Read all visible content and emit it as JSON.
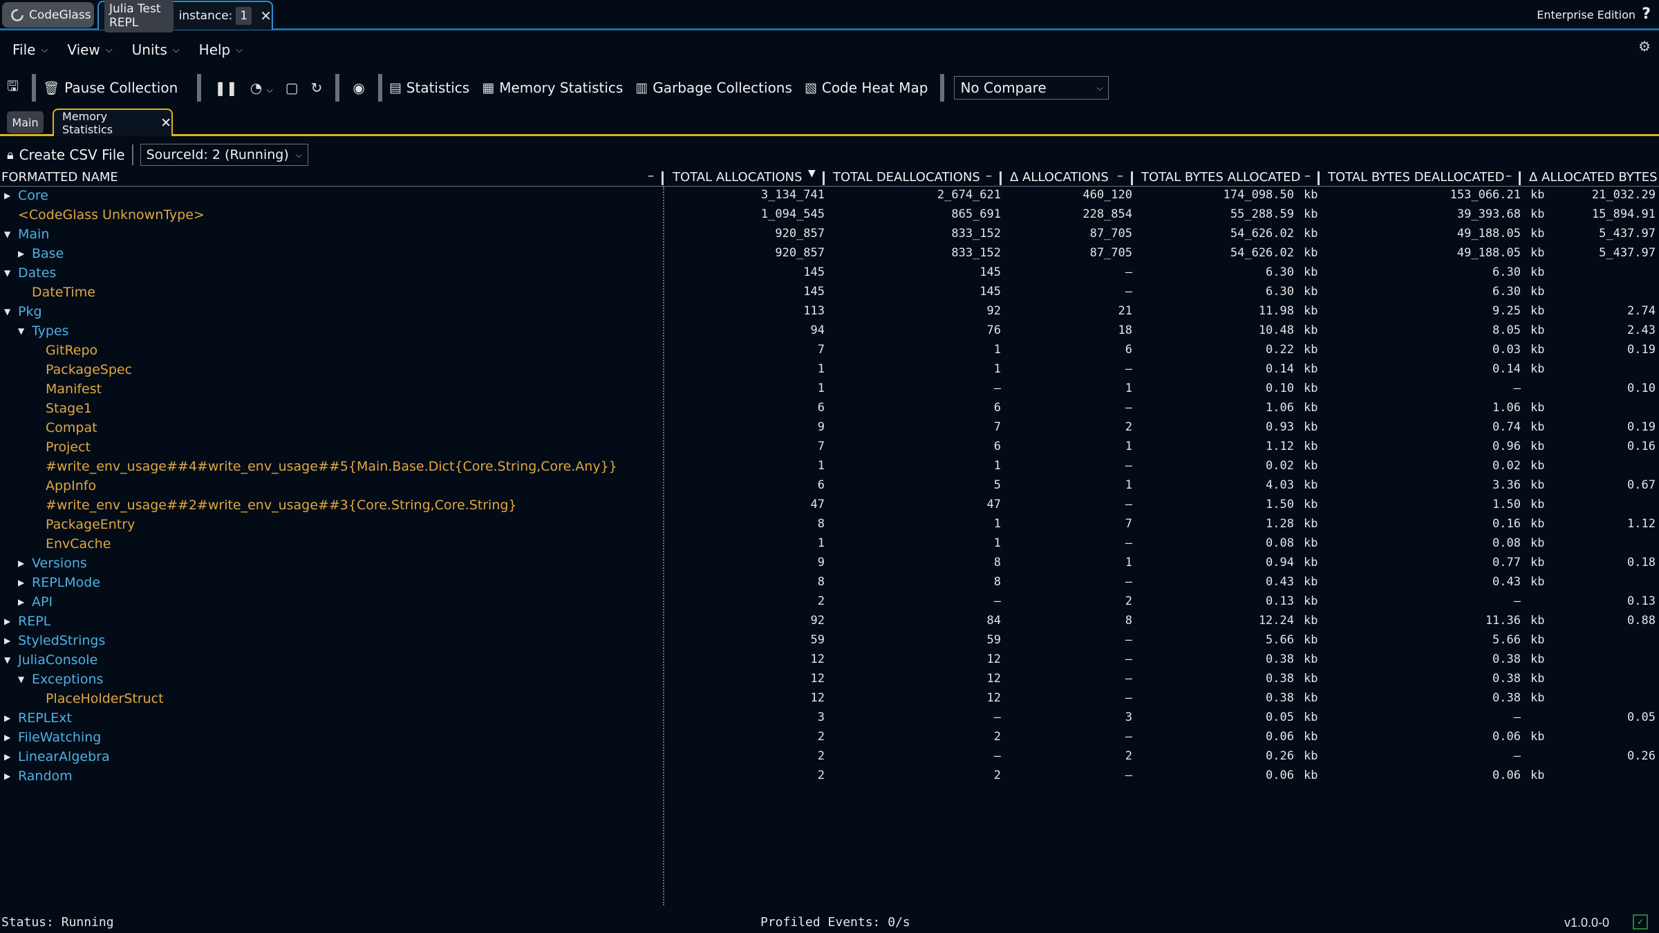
{
  "titlebar": {
    "app_name": "CodeGlass",
    "window_tab_name": "Julia Test REPL",
    "instance_label": "instance:",
    "instance_number": "1",
    "edition": "Enterprise Edition",
    "help": "?"
  },
  "menu": {
    "items": [
      "File",
      "View",
      "Units",
      "Help"
    ]
  },
  "toolbar": {
    "pause_collection": "Pause Collection",
    "statistics": "Statistics",
    "memory_statistics": "Memory Statistics",
    "garbage_collections": "Garbage Collections",
    "code_heat_map": "Code Heat Map",
    "compare_value": "No Compare"
  },
  "doc_tabs": {
    "main": "Main",
    "memory_statistics": "Memory Statistics"
  },
  "actions": {
    "create_csv": "Create CSV File",
    "source_select": "SourceId: 2 (Running)"
  },
  "table": {
    "columns": [
      "FORMATTED NAME",
      "TOTAL ALLOCATIONS",
      "TOTAL DEALLOCATIONS",
      "Δ ALLOCATIONS",
      "TOTAL BYTES ALLOCATED",
      "TOTAL BYTES DEALLOCATED",
      "Δ ALLOCATED BYTES"
    ],
    "unit": "kb",
    "rows": [
      {
        "name": "Core",
        "depth": 0,
        "kind": "ns",
        "tree": "collapsed",
        "alloc": "3_134_741",
        "dealloc": "2_674_621",
        "dalloc": "460_120",
        "bytes": "174_098.50",
        "bytes_unit": "kb",
        "dbytes": "153_066.21",
        "dbytes_unit": "kb",
        "delta_bytes": "21_032.29"
      },
      {
        "name": "<CodeGlass UnknownType>",
        "depth": 0,
        "kind": "ty",
        "tree": "none",
        "alloc": "1_094_545",
        "dealloc": "865_691",
        "dalloc": "228_854",
        "bytes": "55_288.59",
        "bytes_unit": "kb",
        "dbytes": "39_393.68",
        "dbytes_unit": "kb",
        "delta_bytes": "15_894.91"
      },
      {
        "name": "Main",
        "depth": 0,
        "kind": "ns",
        "tree": "expanded",
        "alloc": "920_857",
        "dealloc": "833_152",
        "dalloc": "87_705",
        "bytes": "54_626.02",
        "bytes_unit": "kb",
        "dbytes": "49_188.05",
        "dbytes_unit": "kb",
        "delta_bytes": "5_437.97"
      },
      {
        "name": "Base",
        "depth": 1,
        "kind": "ns",
        "tree": "collapsed",
        "alloc": "920_857",
        "dealloc": "833_152",
        "dalloc": "87_705",
        "bytes": "54_626.02",
        "bytes_unit": "kb",
        "dbytes": "49_188.05",
        "dbytes_unit": "kb",
        "delta_bytes": "5_437.97"
      },
      {
        "name": "Dates",
        "depth": 0,
        "kind": "ns",
        "tree": "expanded",
        "alloc": "145",
        "dealloc": "145",
        "dalloc": "–",
        "bytes": "6.30",
        "bytes_unit": "kb",
        "dbytes": "6.30",
        "dbytes_unit": "kb",
        "delta_bytes": ""
      },
      {
        "name": "DateTime",
        "depth": 1,
        "kind": "ty",
        "tree": "none",
        "alloc": "145",
        "dealloc": "145",
        "dalloc": "–",
        "bytes": "6.30",
        "bytes_unit": "kb",
        "dbytes": "6.30",
        "dbytes_unit": "kb",
        "delta_bytes": ""
      },
      {
        "name": "Pkg",
        "depth": 0,
        "kind": "ns",
        "tree": "expanded",
        "alloc": "113",
        "dealloc": "92",
        "dalloc": "21",
        "bytes": "11.98",
        "bytes_unit": "kb",
        "dbytes": "9.25",
        "dbytes_unit": "kb",
        "delta_bytes": "2.74"
      },
      {
        "name": "Types",
        "depth": 1,
        "kind": "ns",
        "tree": "expanded",
        "alloc": "94",
        "dealloc": "76",
        "dalloc": "18",
        "bytes": "10.48",
        "bytes_unit": "kb",
        "dbytes": "8.05",
        "dbytes_unit": "kb",
        "delta_bytes": "2.43"
      },
      {
        "name": "GitRepo",
        "depth": 2,
        "kind": "ty",
        "tree": "none",
        "alloc": "7",
        "dealloc": "1",
        "dalloc": "6",
        "bytes": "0.22",
        "bytes_unit": "kb",
        "dbytes": "0.03",
        "dbytes_unit": "kb",
        "delta_bytes": "0.19"
      },
      {
        "name": "PackageSpec",
        "depth": 2,
        "kind": "ty",
        "tree": "none",
        "alloc": "1",
        "dealloc": "1",
        "dalloc": "–",
        "bytes": "0.14",
        "bytes_unit": "kb",
        "dbytes": "0.14",
        "dbytes_unit": "kb",
        "delta_bytes": ""
      },
      {
        "name": "Manifest",
        "depth": 2,
        "kind": "ty",
        "tree": "none",
        "alloc": "1",
        "dealloc": "–",
        "dalloc": "1",
        "bytes": "0.10",
        "bytes_unit": "kb",
        "dbytes": "–",
        "dbytes_unit": "",
        "delta_bytes": "0.10"
      },
      {
        "name": "Stage1",
        "depth": 2,
        "kind": "ty",
        "tree": "none",
        "alloc": "6",
        "dealloc": "6",
        "dalloc": "–",
        "bytes": "1.06",
        "bytes_unit": "kb",
        "dbytes": "1.06",
        "dbytes_unit": "kb",
        "delta_bytes": ""
      },
      {
        "name": "Compat",
        "depth": 2,
        "kind": "ty",
        "tree": "none",
        "alloc": "9",
        "dealloc": "7",
        "dalloc": "2",
        "bytes": "0.93",
        "bytes_unit": "kb",
        "dbytes": "0.74",
        "dbytes_unit": "kb",
        "delta_bytes": "0.19"
      },
      {
        "name": "Project",
        "depth": 2,
        "kind": "ty",
        "tree": "none",
        "alloc": "7",
        "dealloc": "6",
        "dalloc": "1",
        "bytes": "1.12",
        "bytes_unit": "kb",
        "dbytes": "0.96",
        "dbytes_unit": "kb",
        "delta_bytes": "0.16"
      },
      {
        "name": "#write_env_usage##4#write_env_usage##5{Main.Base.Dict{Core.String,Core.Any}}",
        "depth": 2,
        "kind": "ty",
        "tree": "none",
        "alloc": "1",
        "dealloc": "1",
        "dalloc": "–",
        "bytes": "0.02",
        "bytes_unit": "kb",
        "dbytes": "0.02",
        "dbytes_unit": "kb",
        "delta_bytes": ""
      },
      {
        "name": "AppInfo",
        "depth": 2,
        "kind": "ty",
        "tree": "none",
        "alloc": "6",
        "dealloc": "5",
        "dalloc": "1",
        "bytes": "4.03",
        "bytes_unit": "kb",
        "dbytes": "3.36",
        "dbytes_unit": "kb",
        "delta_bytes": "0.67"
      },
      {
        "name": "#write_env_usage##2#write_env_usage##3{Core.String,Core.String}",
        "depth": 2,
        "kind": "ty",
        "tree": "none",
        "alloc": "47",
        "dealloc": "47",
        "dalloc": "–",
        "bytes": "1.50",
        "bytes_unit": "kb",
        "dbytes": "1.50",
        "dbytes_unit": "kb",
        "delta_bytes": ""
      },
      {
        "name": "PackageEntry",
        "depth": 2,
        "kind": "ty",
        "tree": "none",
        "alloc": "8",
        "dealloc": "1",
        "dalloc": "7",
        "bytes": "1.28",
        "bytes_unit": "kb",
        "dbytes": "0.16",
        "dbytes_unit": "kb",
        "delta_bytes": "1.12"
      },
      {
        "name": "EnvCache",
        "depth": 2,
        "kind": "ty",
        "tree": "none",
        "alloc": "1",
        "dealloc": "1",
        "dalloc": "–",
        "bytes": "0.08",
        "bytes_unit": "kb",
        "dbytes": "0.08",
        "dbytes_unit": "kb",
        "delta_bytes": ""
      },
      {
        "name": "Versions",
        "depth": 1,
        "kind": "ns",
        "tree": "collapsed",
        "alloc": "9",
        "dealloc": "8",
        "dalloc": "1",
        "bytes": "0.94",
        "bytes_unit": "kb",
        "dbytes": "0.77",
        "dbytes_unit": "kb",
        "delta_bytes": "0.18"
      },
      {
        "name": "REPLMode",
        "depth": 1,
        "kind": "ns",
        "tree": "collapsed",
        "alloc": "8",
        "dealloc": "8",
        "dalloc": "–",
        "bytes": "0.43",
        "bytes_unit": "kb",
        "dbytes": "0.43",
        "dbytes_unit": "kb",
        "delta_bytes": ""
      },
      {
        "name": "API",
        "depth": 1,
        "kind": "ns",
        "tree": "collapsed",
        "alloc": "2",
        "dealloc": "–",
        "dalloc": "2",
        "bytes": "0.13",
        "bytes_unit": "kb",
        "dbytes": "–",
        "dbytes_unit": "",
        "delta_bytes": "0.13"
      },
      {
        "name": "REPL",
        "depth": 0,
        "kind": "ns",
        "tree": "collapsed",
        "alloc": "92",
        "dealloc": "84",
        "dalloc": "8",
        "bytes": "12.24",
        "bytes_unit": "kb",
        "dbytes": "11.36",
        "dbytes_unit": "kb",
        "delta_bytes": "0.88"
      },
      {
        "name": "StyledStrings",
        "depth": 0,
        "kind": "ns",
        "tree": "collapsed",
        "alloc": "59",
        "dealloc": "59",
        "dalloc": "–",
        "bytes": "5.66",
        "bytes_unit": "kb",
        "dbytes": "5.66",
        "dbytes_unit": "kb",
        "delta_bytes": ""
      },
      {
        "name": "JuliaConsole",
        "depth": 0,
        "kind": "ns",
        "tree": "expanded",
        "alloc": "12",
        "dealloc": "12",
        "dalloc": "–",
        "bytes": "0.38",
        "bytes_unit": "kb",
        "dbytes": "0.38",
        "dbytes_unit": "kb",
        "delta_bytes": ""
      },
      {
        "name": "Exceptions",
        "depth": 1,
        "kind": "ns",
        "tree": "expanded",
        "alloc": "12",
        "dealloc": "12",
        "dalloc": "–",
        "bytes": "0.38",
        "bytes_unit": "kb",
        "dbytes": "0.38",
        "dbytes_unit": "kb",
        "delta_bytes": ""
      },
      {
        "name": "PlaceHolderStruct",
        "depth": 2,
        "kind": "ty",
        "tree": "none",
        "alloc": "12",
        "dealloc": "12",
        "dalloc": "–",
        "bytes": "0.38",
        "bytes_unit": "kb",
        "dbytes": "0.38",
        "dbytes_unit": "kb",
        "delta_bytes": ""
      },
      {
        "name": "REPLExt",
        "depth": 0,
        "kind": "ns",
        "tree": "collapsed",
        "alloc": "3",
        "dealloc": "–",
        "dalloc": "3",
        "bytes": "0.05",
        "bytes_unit": "kb",
        "dbytes": "–",
        "dbytes_unit": "",
        "delta_bytes": "0.05"
      },
      {
        "name": "FileWatching",
        "depth": 0,
        "kind": "ns",
        "tree": "collapsed",
        "alloc": "2",
        "dealloc": "2",
        "dalloc": "–",
        "bytes": "0.06",
        "bytes_unit": "kb",
        "dbytes": "0.06",
        "dbytes_unit": "kb",
        "delta_bytes": ""
      },
      {
        "name": "LinearAlgebra",
        "depth": 0,
        "kind": "ns",
        "tree": "collapsed",
        "alloc": "2",
        "dealloc": "–",
        "dalloc": "2",
        "bytes": "0.26",
        "bytes_unit": "kb",
        "dbytes": "–",
        "dbytes_unit": "",
        "delta_bytes": "0.26"
      },
      {
        "name": "Random",
        "depth": 0,
        "kind": "ns",
        "tree": "collapsed",
        "alloc": "2",
        "dealloc": "2",
        "dalloc": "–",
        "bytes": "0.06",
        "bytes_unit": "kb",
        "dbytes": "0.06",
        "dbytes_unit": "kb",
        "delta_bytes": ""
      }
    ]
  },
  "status": {
    "left": "Status: Running",
    "middle": "Profiled Events: 0/s",
    "version": "v1.0.0-0"
  },
  "colors": {
    "namespace": "#4fb1e6",
    "type": "#e0a842",
    "tab_accent": "#e2b019",
    "window_accent": "#2b8fd0"
  }
}
